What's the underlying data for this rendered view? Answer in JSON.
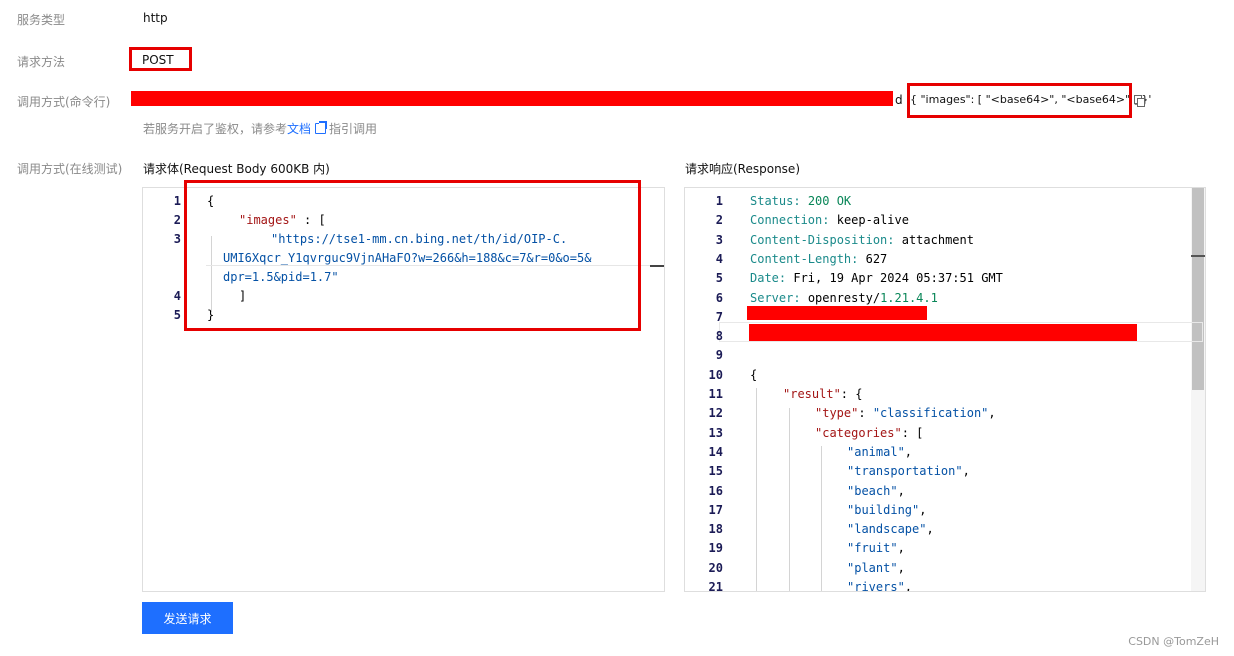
{
  "service": {
    "type_label": "服务类型",
    "type_value": "http",
    "method_label": "请求方法",
    "method_value": "POST",
    "cmd_label": "调用方式(命令行)",
    "cmd_suffix_char": "d",
    "cmd_payload": "{ \"images\": [ \"<base64>\", \"<base64>\" ] }'",
    "auth_hint_prefix": "若服务开启了鉴权，请参考",
    "auth_hint_link": "文档",
    "auth_hint_suffix": "指引调用",
    "online_label": "调用方式(在线测试)"
  },
  "request": {
    "title": "请求体(Request Body 600KB 内)",
    "lines": [
      {
        "num": "1",
        "text": "{"
      },
      {
        "num": "2",
        "key": "\"images\"",
        "rest": " : ["
      },
      {
        "num": "3",
        "text": "\"https://tse1-mm.cn.bing.net/th/id/OIP-C."
      },
      {
        "num": "",
        "text": "UMI6Xqcr_Y1qvrguc9VjnAHaFO?w=266&h=188&c=7&r=0&o=5&"
      },
      {
        "num": "",
        "text": "dpr=1.5&pid=1.7\""
      },
      {
        "num": "4",
        "text": "]"
      },
      {
        "num": "5",
        "text": "}"
      }
    ]
  },
  "response": {
    "title": "请求响应(Response)",
    "headers": [
      {
        "num": "1",
        "name": "Status:",
        "value": "200 OK"
      },
      {
        "num": "2",
        "name": "Connection:",
        "value": "keep-alive"
      },
      {
        "num": "3",
        "name": "Content-Disposition:",
        "value": "attachment"
      },
      {
        "num": "4",
        "name": "Content-Length:",
        "value": "627"
      },
      {
        "num": "5",
        "name": "Date:",
        "value": "Fri, 19 Apr 2024 05:37:51 GMT"
      },
      {
        "num": "6",
        "name": "Server:",
        "value": "openresty/",
        "value2": "1.21.4.1"
      },
      {
        "num": "7"
      },
      {
        "num": "8"
      },
      {
        "num": "9"
      }
    ],
    "body": [
      {
        "num": "10",
        "text": "{"
      },
      {
        "num": "11",
        "key": "\"result\"",
        "rest": ": {"
      },
      {
        "num": "12",
        "key": "\"type\"",
        "rest": ": ",
        "val": "\"classification\"",
        "tail": ","
      },
      {
        "num": "13",
        "key": "\"categories\"",
        "rest": ": ["
      },
      {
        "num": "14",
        "val": "\"animal\"",
        "tail": ","
      },
      {
        "num": "15",
        "val": "\"transportation\"",
        "tail": ","
      },
      {
        "num": "16",
        "val": "\"beach\"",
        "tail": ","
      },
      {
        "num": "17",
        "val": "\"building\"",
        "tail": ","
      },
      {
        "num": "18",
        "val": "\"landscape\"",
        "tail": ","
      },
      {
        "num": "19",
        "val": "\"fruit\"",
        "tail": ","
      },
      {
        "num": "20",
        "val": "\"plant\"",
        "tail": ","
      },
      {
        "num": "21",
        "val": "\"rivers\"",
        "tail": ","
      }
    ]
  },
  "send_button": "发送请求",
  "watermark": "CSDN @TomZeH",
  "colors": {
    "accent": "#1e6fff",
    "redaction": "#ff0000",
    "highlight_border": "#e60000"
  }
}
